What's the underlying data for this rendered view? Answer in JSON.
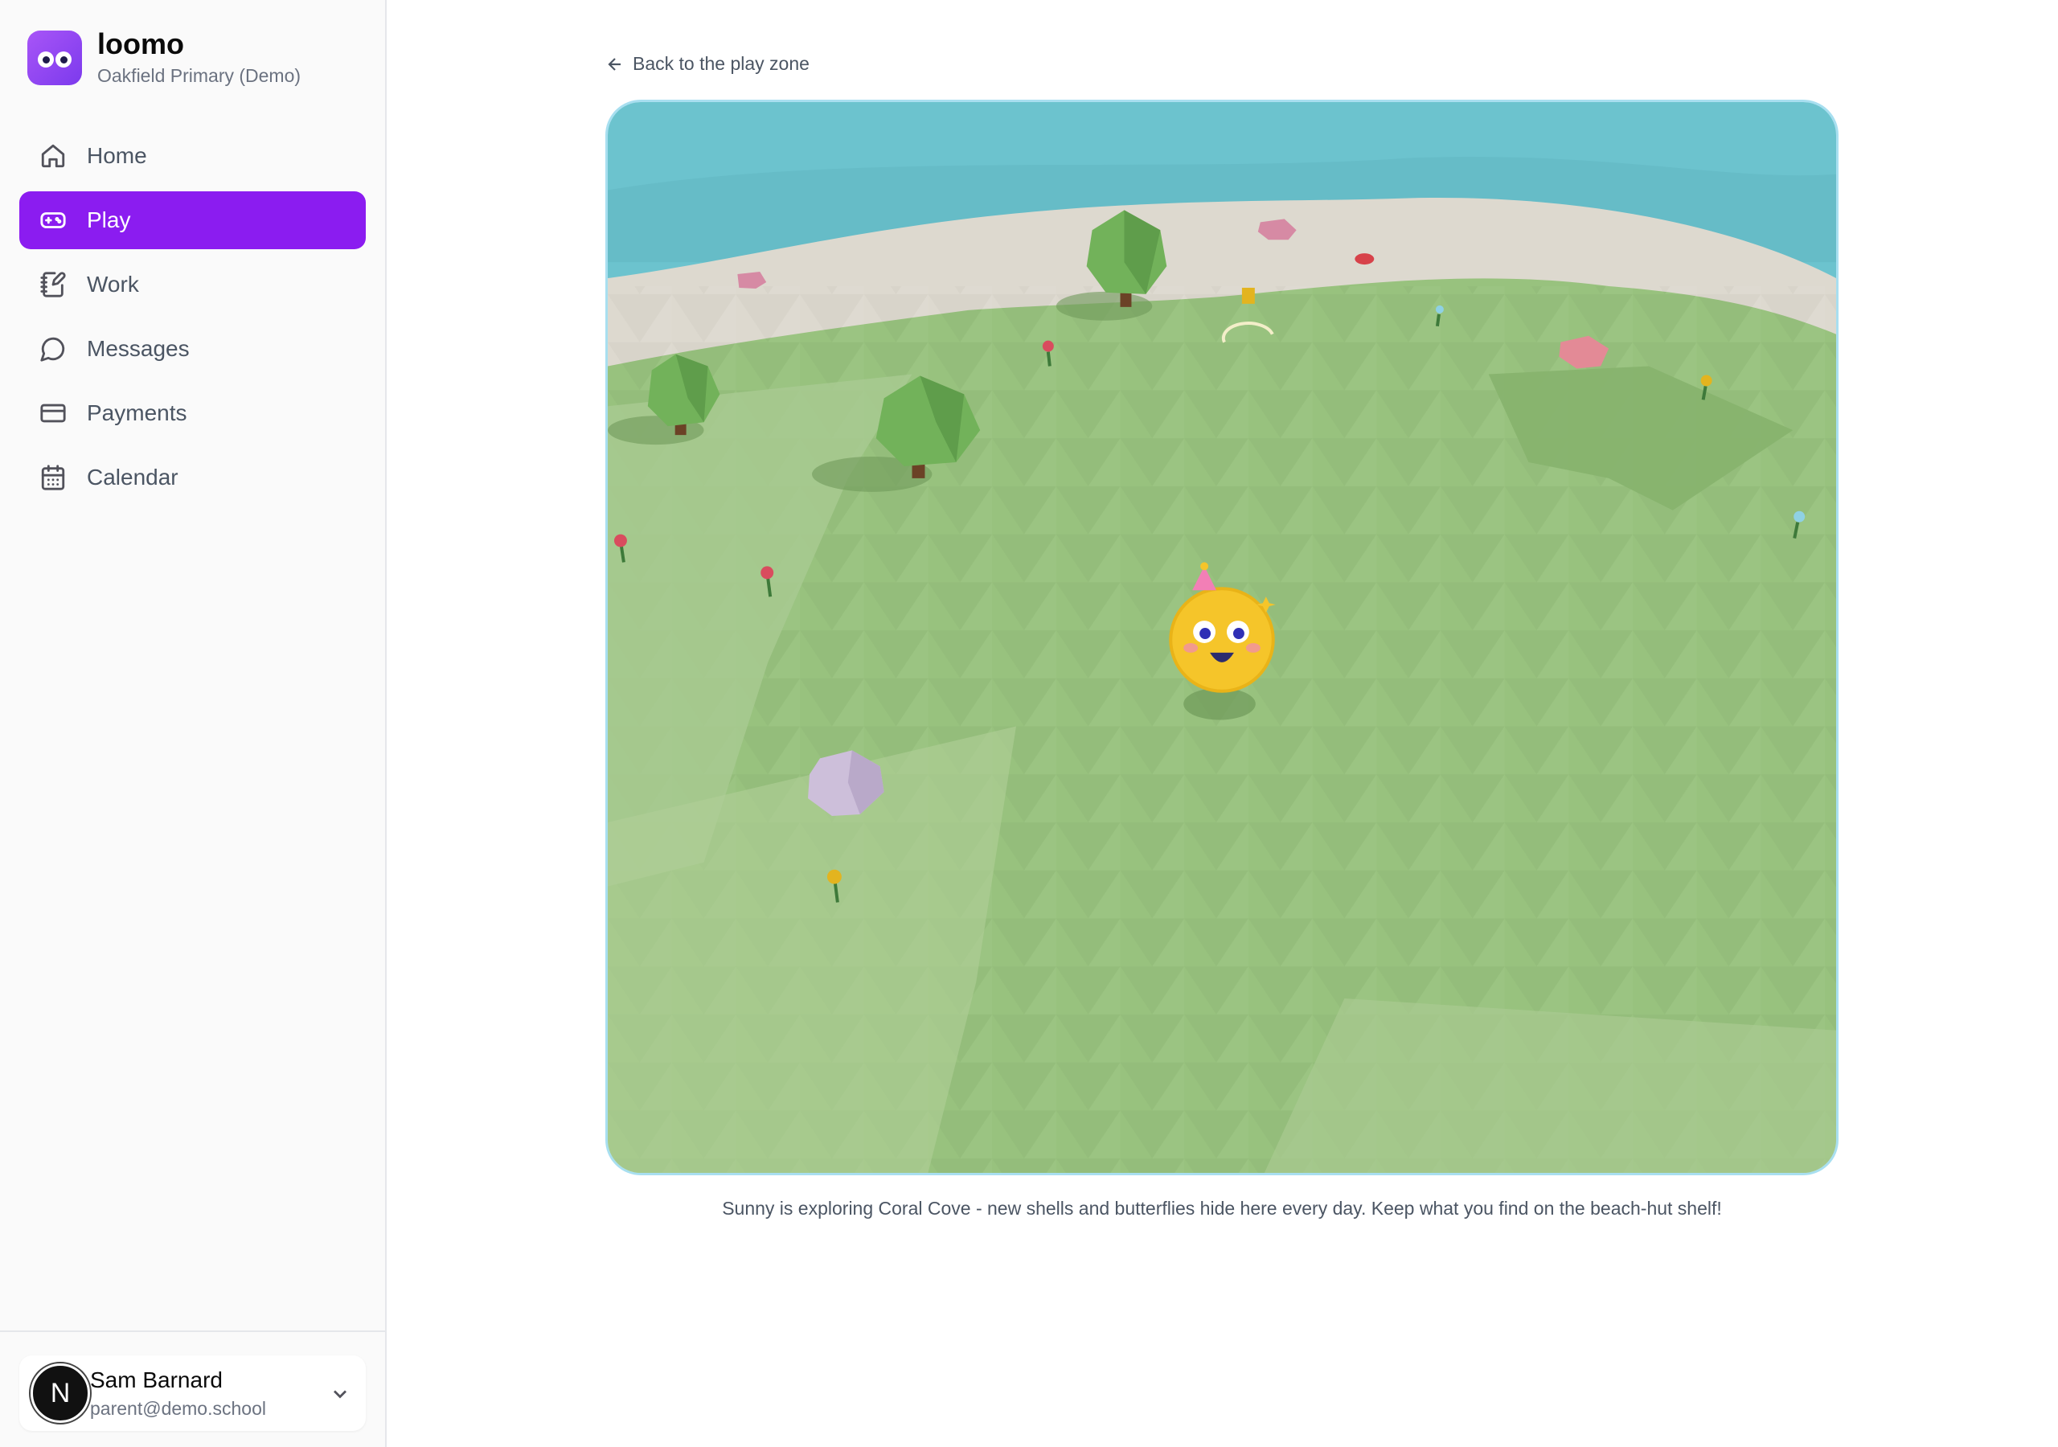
{
  "brand": {
    "name": "loomo",
    "school": "Oakfield Primary (Demo)",
    "logo_icon": "eyes-logo-icon",
    "accent": "#8b1cf0"
  },
  "nav": {
    "items": [
      {
        "label": "Home",
        "icon": "home-icon",
        "active": false
      },
      {
        "label": "Play",
        "icon": "gamepad-icon",
        "active": true
      },
      {
        "label": "Work",
        "icon": "notebook-pen-icon",
        "active": false
      },
      {
        "label": "Messages",
        "icon": "message-circle-icon",
        "active": false
      },
      {
        "label": "Payments",
        "icon": "credit-card-icon",
        "active": false
      },
      {
        "label": "Calendar",
        "icon": "calendar-icon",
        "active": false
      }
    ]
  },
  "user": {
    "initial": "N",
    "name": "Sam Barnard",
    "email": "parent@demo.school"
  },
  "page": {
    "back_label": "Back to the play zone",
    "caption": "Sunny is exploring Coral Cove - new shells and butterflies hide here every day. Keep what you find on the beach-hut shelf!"
  },
  "game": {
    "sea_color": "#6cc3ce",
    "sand_color": "#ddd9cf",
    "grass_color": "#98c27e",
    "frame_border": "#a8dff0"
  }
}
